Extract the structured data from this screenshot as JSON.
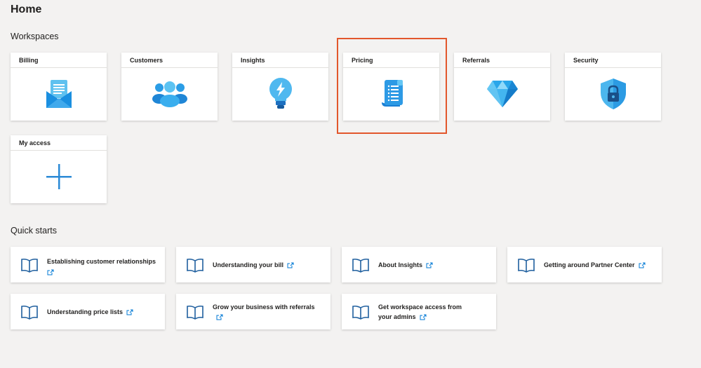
{
  "page": {
    "title": "Home"
  },
  "workspaces": {
    "heading": "Workspaces",
    "items": [
      {
        "label": "Billing",
        "icon": "billing-envelope-icon"
      },
      {
        "label": "Customers",
        "icon": "customers-group-icon"
      },
      {
        "label": "Insights",
        "icon": "insights-lightbulb-icon"
      },
      {
        "label": "Pricing",
        "icon": "pricing-scroll-icon"
      },
      {
        "label": "Referrals",
        "icon": "referrals-diamond-icon"
      },
      {
        "label": "Security",
        "icon": "security-shield-lock-icon"
      },
      {
        "label": "My access",
        "icon": "plus-icon"
      }
    ],
    "highlighted": "Pricing"
  },
  "quickstarts": {
    "heading": "Quick starts",
    "items": [
      {
        "label": "Establishing customer relationships",
        "icon": "book-icon"
      },
      {
        "label": "Understanding your bill",
        "icon": "book-icon"
      },
      {
        "label": "About Insights",
        "icon": "book-icon"
      },
      {
        "label": "Getting around Partner Center",
        "icon": "book-icon"
      },
      {
        "label": "Understanding price lists",
        "icon": "book-icon"
      },
      {
        "label": "Grow your business with referrals",
        "icon": "book-icon"
      },
      {
        "label": "Get workspace access from your admins",
        "icon": "book-icon"
      }
    ]
  },
  "colors": {
    "accent": "#0078d4",
    "highlight": "#e2572c",
    "background": "#f3f2f1"
  }
}
